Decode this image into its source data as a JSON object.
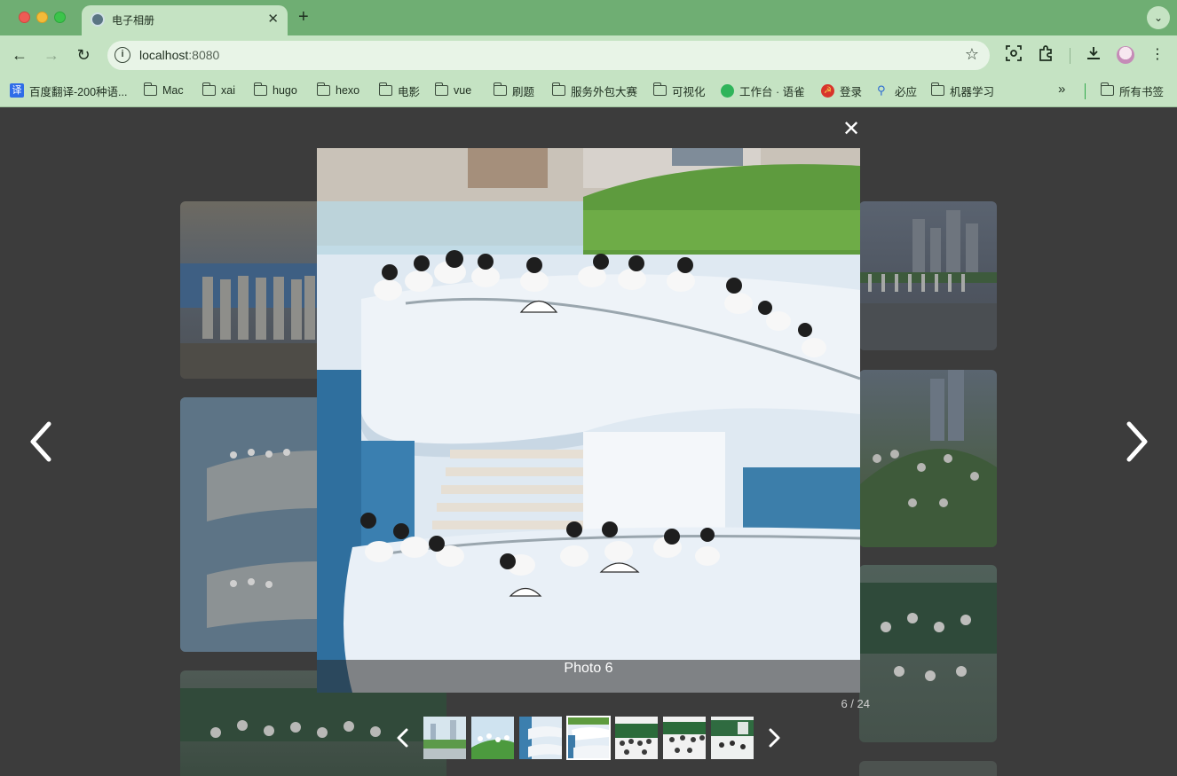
{
  "browser": {
    "tab_title": "电子相册",
    "tab_close": "✕",
    "new_tab": "+",
    "url_host": "localhost",
    "url_port": ":8080",
    "bookmarks": [
      {
        "label": "百度翻译-200种语...",
        "icon": "fanyi-icon"
      },
      {
        "label": "Mac",
        "icon": "folder-icon"
      },
      {
        "label": "xai",
        "icon": "folder-icon"
      },
      {
        "label": "hugo",
        "icon": "folder-icon"
      },
      {
        "label": "hexo",
        "icon": "folder-icon"
      },
      {
        "label": "电影",
        "icon": "folder-icon"
      },
      {
        "label": "vue",
        "icon": "folder-icon"
      },
      {
        "label": "刷题",
        "icon": "folder-icon"
      },
      {
        "label": "服务外包大赛",
        "icon": "folder-icon"
      },
      {
        "label": "可视化",
        "icon": "folder-icon"
      },
      {
        "label": "工作台 · 语雀",
        "icon": "yuque-icon"
      },
      {
        "label": "登录",
        "icon": "login-icon"
      },
      {
        "label": "必应",
        "icon": "bing-icon"
      },
      {
        "label": "机器学习",
        "icon": "folder-icon"
      }
    ],
    "bookmarks_more": "»",
    "all_bookmarks": "所有书签"
  },
  "lightbox": {
    "caption": "Photo 6",
    "counter": "6 / 24",
    "current_index": 6,
    "total": 24,
    "close_label": "✕",
    "thumbnails": [
      {
        "name": "thumb-1",
        "active": false
      },
      {
        "name": "thumb-2",
        "active": false
      },
      {
        "name": "thumb-3",
        "active": false
      },
      {
        "name": "thumb-4",
        "active": true
      },
      {
        "name": "thumb-5",
        "active": false
      },
      {
        "name": "thumb-6",
        "active": false
      },
      {
        "name": "thumb-7",
        "active": false
      }
    ]
  },
  "colors": {
    "chrome_title": "#6fae73",
    "chrome_toolbar": "#c5e3c3",
    "overlay_bg": "#3a3a3a",
    "accent_white": "#ffffff"
  }
}
